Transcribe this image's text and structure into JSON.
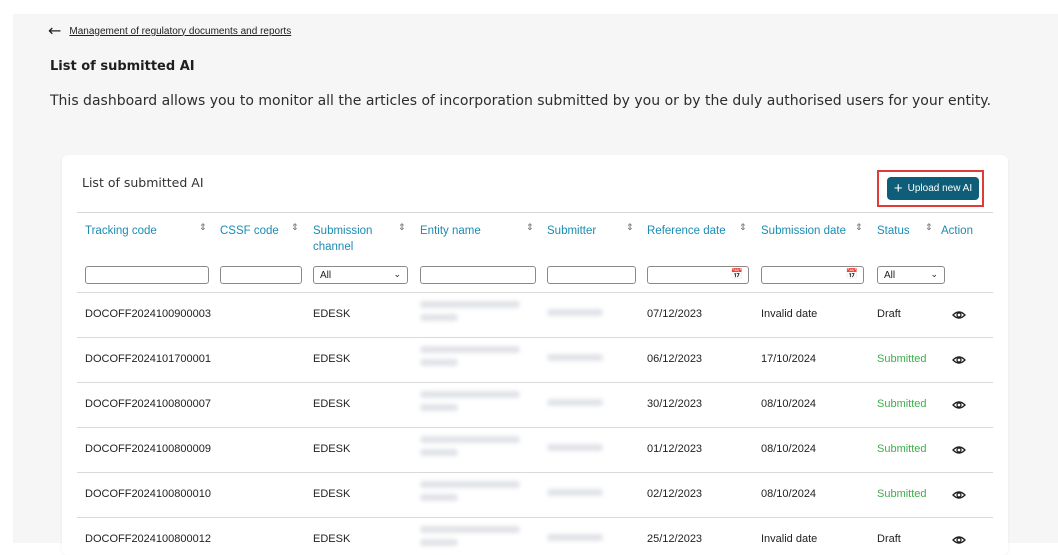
{
  "nav": {
    "back_link": "Management of regulatory documents and reports"
  },
  "page": {
    "title": "List of submitted AI",
    "description": "This dashboard allows you to monitor all the articles of incorporation submitted by you or by the duly authorised users for your entity."
  },
  "card": {
    "title": "List of submitted AI",
    "upload_label": "Upload new AI"
  },
  "table": {
    "columns": [
      "Tracking code",
      "CSSF code",
      "Submission channel",
      "Entity name",
      "Submitter",
      "Reference date",
      "Submission date",
      "Status",
      "Action"
    ],
    "filters": {
      "channel_selected": "All",
      "status_selected": "All"
    },
    "rows": [
      {
        "tracking": "DOCOFF2024100900003",
        "cssf": "",
        "channel": "EDESK",
        "reference": "07/12/2023",
        "submission": "Invalid date",
        "status": "Draft"
      },
      {
        "tracking": "DOCOFF2024101700001",
        "cssf": "",
        "channel": "EDESK",
        "reference": "06/12/2023",
        "submission": "17/10/2024",
        "status": "Submitted"
      },
      {
        "tracking": "DOCOFF2024100800007",
        "cssf": "",
        "channel": "EDESK",
        "reference": "30/12/2023",
        "submission": "08/10/2024",
        "status": "Submitted"
      },
      {
        "tracking": "DOCOFF2024100800009",
        "cssf": "",
        "channel": "EDESK",
        "reference": "01/12/2023",
        "submission": "08/10/2024",
        "status": "Submitted"
      },
      {
        "tracking": "DOCOFF2024100800010",
        "cssf": "",
        "channel": "EDESK",
        "reference": "02/12/2023",
        "submission": "08/10/2024",
        "status": "Submitted"
      },
      {
        "tracking": "DOCOFF2024100800012",
        "cssf": "",
        "channel": "EDESK",
        "reference": "25/12/2023",
        "submission": "Invalid date",
        "status": "Draft"
      }
    ]
  },
  "colors": {
    "primary": "#0e5e79",
    "header_link": "#1a8cb3",
    "submitted": "#3fae4a",
    "highlight": "#e03a3a"
  },
  "icons": {
    "back": "arrow-left-icon",
    "upload": "plus-icon",
    "sort": "sort-icon",
    "calendar": "calendar-icon",
    "view": "eye-icon"
  }
}
